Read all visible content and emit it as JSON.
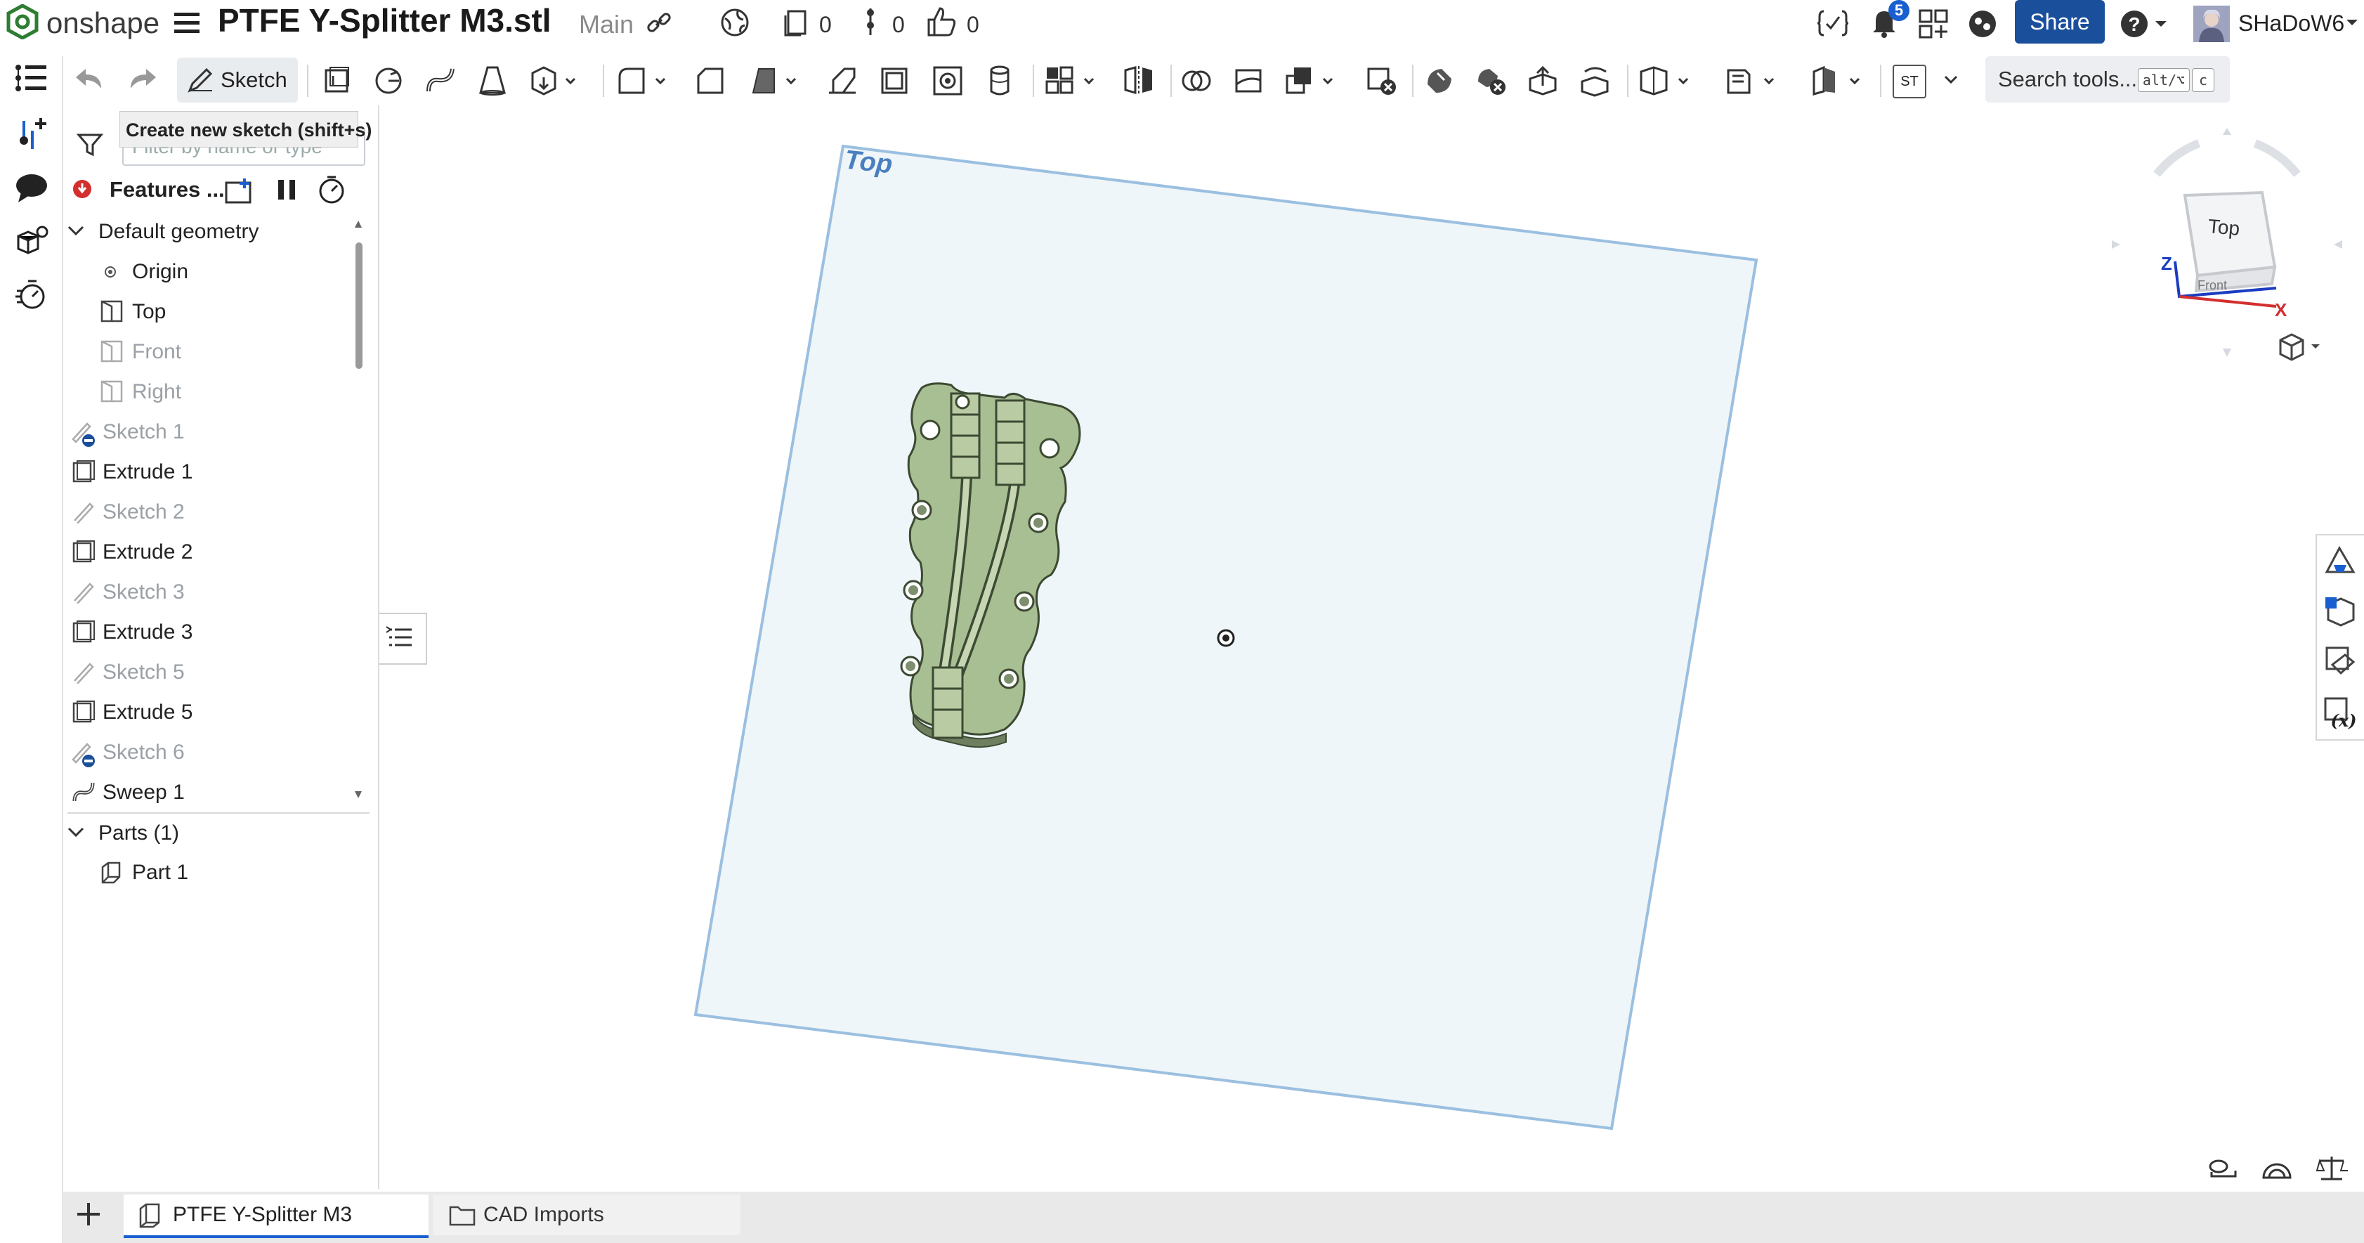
{
  "app": {
    "name": "onshape"
  },
  "header": {
    "document_title": "PTFE Y-Splitter M3.stl",
    "workspace": "Main",
    "versions_count": "0",
    "branches_count": "0",
    "likes_count": "0",
    "notifications_count": "5",
    "share_label": "Share",
    "user_name": "SHaDoW6"
  },
  "toolbar": {
    "sketch_label": "Sketch",
    "search_label": "Search tools...",
    "search_key1": "alt/⌥",
    "search_key2": "c",
    "st_label": "ST",
    "tooltip": "Create new sketch (shift+s)"
  },
  "feature_panel": {
    "filter_placeholder": "Filter by name or type",
    "header_label": "Features ...",
    "items": [
      {
        "label": "Default geometry",
        "kind": "group",
        "suppressed": false
      },
      {
        "label": "Origin",
        "kind": "origin",
        "suppressed": false
      },
      {
        "label": "Top",
        "kind": "plane",
        "suppressed": false
      },
      {
        "label": "Front",
        "kind": "plane",
        "suppressed": true
      },
      {
        "label": "Right",
        "kind": "plane",
        "suppressed": true
      },
      {
        "label": "Sketch 1",
        "kind": "sketch",
        "suppressed": true
      },
      {
        "label": "Extrude 1",
        "kind": "extrude",
        "suppressed": false
      },
      {
        "label": "Sketch 2",
        "kind": "sketch",
        "suppressed": true
      },
      {
        "label": "Extrude 2",
        "kind": "extrude",
        "suppressed": false
      },
      {
        "label": "Sketch 3",
        "kind": "sketch",
        "suppressed": true
      },
      {
        "label": "Extrude 3",
        "kind": "extrude",
        "suppressed": false
      },
      {
        "label": "Sketch 5",
        "kind": "sketch",
        "suppressed": true
      },
      {
        "label": "Extrude 5",
        "kind": "extrude",
        "suppressed": false
      },
      {
        "label": "Sketch 6",
        "kind": "sketch",
        "suppressed": true
      },
      {
        "label": "Sweep 1",
        "kind": "sweep",
        "suppressed": false
      }
    ],
    "parts_label": "Parts (1)",
    "part_label": "Part 1"
  },
  "viewport": {
    "plane_label": "Top",
    "view_cube_face": "Top",
    "view_cube_front": "Front",
    "axis_x": "X",
    "axis_z": "Z",
    "plane_color": "#eef6f9",
    "plane_border_color": "#9bbfe0",
    "part_color": "#a8bf93"
  },
  "tabs": [
    {
      "label": "PTFE Y-Splitter M3",
      "active": true
    },
    {
      "label": "CAD Imports",
      "active": false
    }
  ],
  "colors": {
    "accent": "#1a5fd0",
    "share_bg": "#1a4f9c",
    "logo_green": "#2e7d32",
    "error_red": "#d32f2f"
  }
}
